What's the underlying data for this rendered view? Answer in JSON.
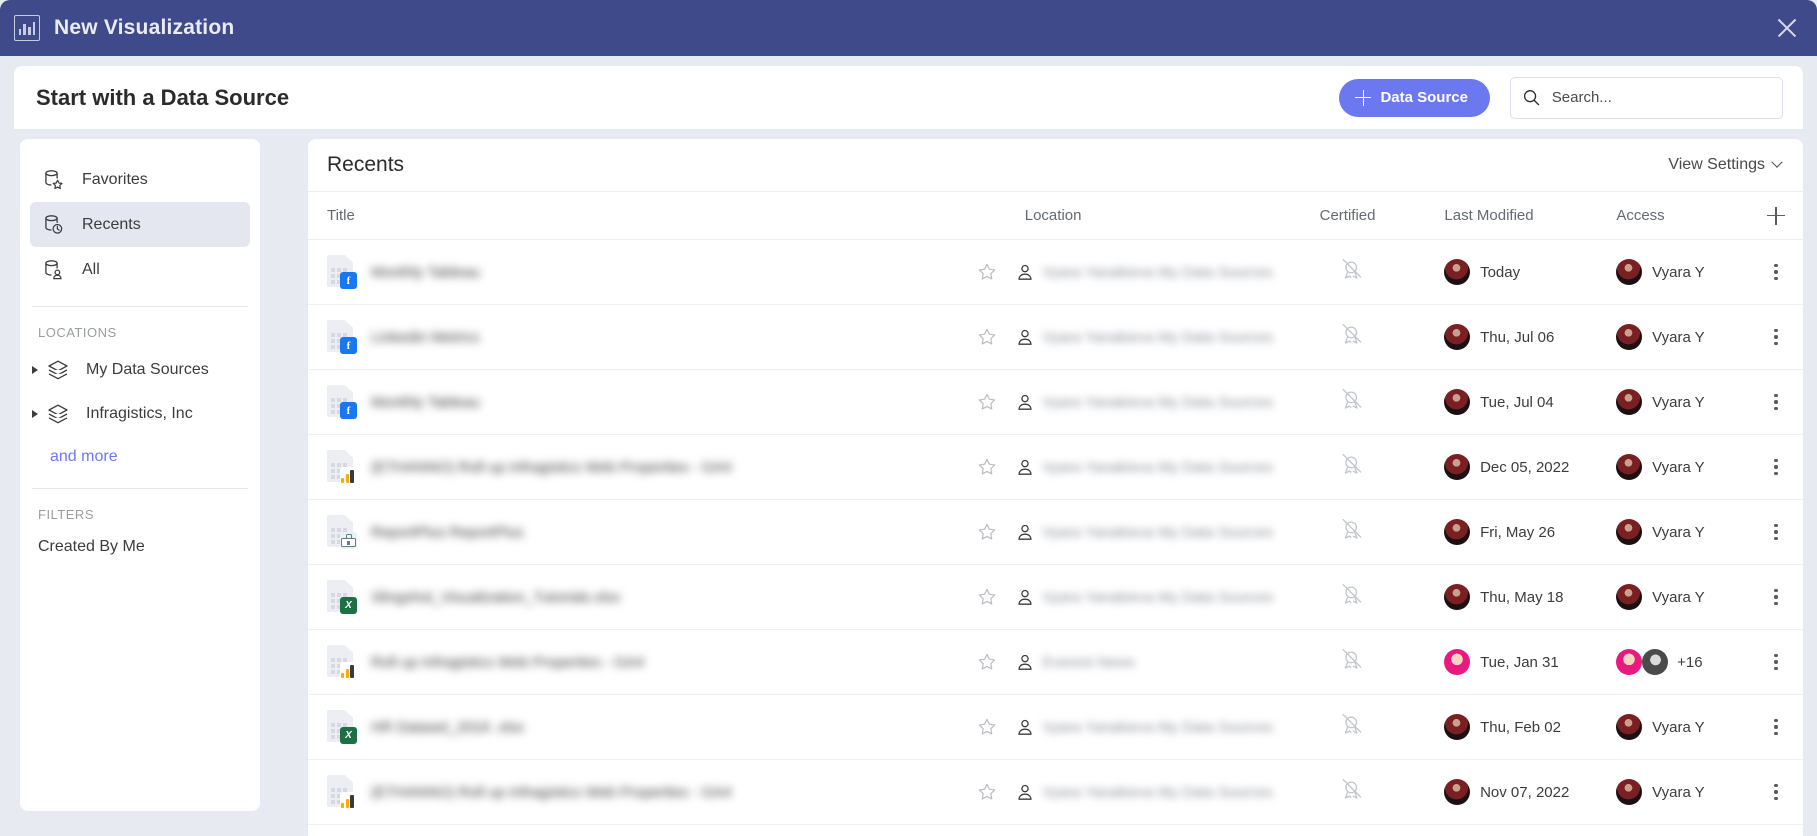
{
  "window": {
    "title": "New Visualization",
    "title_icon": "bar-chart-icon",
    "close_icon": "close-icon",
    "accent_color": "#3f4a8a"
  },
  "header": {
    "title": "Start with a Data Source",
    "data_source_button": "Data Source",
    "data_source_button_color": "#6c78f0",
    "search": {
      "placeholder": "Search...",
      "value": "",
      "icon": "search-icon"
    }
  },
  "sidebar": {
    "nav": [
      {
        "label": "Favorites",
        "icon": "database-star-icon",
        "active": false
      },
      {
        "label": "Recents",
        "icon": "database-clock-icon",
        "active": true
      },
      {
        "label": "All",
        "icon": "database-user-icon",
        "active": false
      }
    ],
    "locations_label": "LOCATIONS",
    "locations": [
      {
        "label": "My Data Sources",
        "icon": "layers-icon"
      },
      {
        "label": "Infragistics, Inc",
        "icon": "layers-icon"
      }
    ],
    "and_more": "and more",
    "and_more_color": "#6c78f0",
    "filters_label": "FILTERS",
    "filters": [
      {
        "label": "Created By Me"
      }
    ]
  },
  "main": {
    "title": "Recents",
    "view_settings": "View Settings",
    "columns": {
      "title": "Title",
      "location": "Location",
      "certified": "Certified",
      "last_modified": "Last Modified",
      "access": "Access",
      "add": "add-column-icon"
    },
    "rows": [
      {
        "title": "Monthly Tableau",
        "badge": "facebook",
        "location": "Vyara Yanakieva My Data Sources",
        "certified": false,
        "modified": "Today",
        "modified_avatar": "maroon",
        "access": [
          {
            "name": "Vyara Y",
            "avatar": "maroon"
          }
        ],
        "access_extra": ""
      },
      {
        "title": "Linkedin Metrics",
        "badge": "facebook",
        "location": "Vyara Yanakieva My Data Sources",
        "certified": false,
        "modified": "Thu, Jul 06",
        "modified_avatar": "maroon",
        "access": [
          {
            "name": "Vyara Y",
            "avatar": "maroon"
          }
        ],
        "access_extra": ""
      },
      {
        "title": "Monthly Tableau",
        "badge": "facebook",
        "location": "Vyara Yanakieva My Data Sources",
        "certified": false,
        "modified": "Tue, Jul 04",
        "modified_avatar": "maroon",
        "access": [
          {
            "name": "Vyara Y",
            "avatar": "maroon"
          }
        ],
        "access_extra": ""
      },
      {
        "title": "(ETHANNO) Roll up Infragistics Web Properties - GA4",
        "badge": "analytics",
        "location": "Vyara Yanakieva My Data Sources",
        "certified": false,
        "modified": "Dec 05, 2022",
        "modified_avatar": "maroon",
        "access": [
          {
            "name": "Vyara Y",
            "avatar": "maroon"
          }
        ],
        "access_extra": ""
      },
      {
        "title": "ReportPlus ReportPlus",
        "badge": "reportplus",
        "location": "Vyara Yanakieva My Data Sources",
        "certified": false,
        "modified": "Fri, May 26",
        "modified_avatar": "maroon",
        "access": [
          {
            "name": "Vyara Y",
            "avatar": "maroon"
          }
        ],
        "access_extra": ""
      },
      {
        "title": "Slingshot_Visualization_Tutorials.xlsx",
        "badge": "excel",
        "location": "Vyara Yanakieva My Data Sources",
        "certified": false,
        "modified": "Thu, May 18",
        "modified_avatar": "maroon",
        "access": [
          {
            "name": "Vyara Y",
            "avatar": "maroon"
          }
        ],
        "access_extra": ""
      },
      {
        "title": "Roll up Infragistics Web Properties - GA4",
        "badge": "analytics",
        "location": "Everest News",
        "certified": false,
        "modified": "Tue, Jan 31",
        "modified_avatar": "pink",
        "access": [
          {
            "name": "",
            "avatar": "pink"
          },
          {
            "name": "",
            "avatar": "grey"
          }
        ],
        "access_extra": "+16"
      },
      {
        "title": "HR Dataset_2016 .xlsx",
        "badge": "excel",
        "location": "Vyara Yanakieva My Data Sources",
        "certified": false,
        "modified": "Thu, Feb 02",
        "modified_avatar": "maroon",
        "access": [
          {
            "name": "Vyara Y",
            "avatar": "maroon"
          }
        ],
        "access_extra": ""
      },
      {
        "title": "(ETHANNO) Roll up Infragistics Web Properties - GA4",
        "badge": "analytics",
        "location": "Vyara Yanakieva My Data Sources",
        "certified": false,
        "modified": "Nov 07, 2022",
        "modified_avatar": "maroon",
        "access": [
          {
            "name": "Vyara Y",
            "avatar": "maroon"
          }
        ],
        "access_extra": ""
      }
    ]
  }
}
